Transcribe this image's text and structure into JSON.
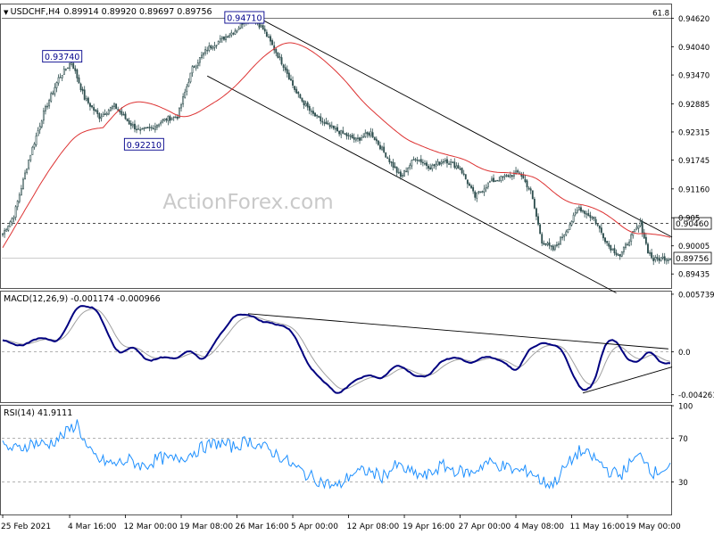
{
  "header": {
    "symbol_timeframe": "USDCHF,H4",
    "ohlc": "0.89914 0.89920 0.89697 0.89756"
  },
  "watermark": "ActionForex.com",
  "chart_data": [
    {
      "type": "candlestick",
      "title": "USDCHF,H4 0.89914 0.89920 0.89697 0.89756",
      "ylim": [
        0.8915,
        0.949
      ],
      "y_ticks": [
        {
          "value": 0.9462,
          "label": "0.94620"
        },
        {
          "value": 0.9404,
          "label": "0.94040"
        },
        {
          "value": 0.9347,
          "label": "0.93470"
        },
        {
          "value": 0.92885,
          "label": "0.92885"
        },
        {
          "value": 0.92315,
          "label": "0.92315"
        },
        {
          "value": 0.91745,
          "label": "0.91745"
        },
        {
          "value": 0.9116,
          "label": "0.91160"
        },
        {
          "value": 0.90575,
          "label": "0.905"
        },
        {
          "value": 0.90005,
          "label": "0.90005"
        },
        {
          "value": 0.89435,
          "label": "0.89435"
        }
      ],
      "x_ticks": [
        {
          "bar": 0,
          "label": "25 Feb 2021"
        },
        {
          "bar": 36,
          "label": "4 Mar 16:00"
        },
        {
          "bar": 66,
          "label": "12 Mar 00:00"
        },
        {
          "bar": 96,
          "label": "19 Mar 08:00"
        },
        {
          "bar": 126,
          "label": "26 Mar 16:00"
        },
        {
          "bar": 156,
          "label": "5 Apr 00:00"
        },
        {
          "bar": 186,
          "label": "12 Apr 08:00"
        },
        {
          "bar": 216,
          "label": "19 Apr 16:00"
        },
        {
          "bar": 246,
          "label": "27 Apr 00:00"
        },
        {
          "bar": 276,
          "label": "4 May 08:00"
        },
        {
          "bar": 306,
          "label": "11 May 16:00"
        },
        {
          "bar": 336,
          "label": "19 May 00:00"
        }
      ],
      "bar_count": 360,
      "anchors": [
        [
          0,
          0.9025
        ],
        [
          6,
          0.9062
        ],
        [
          14,
          0.9175
        ],
        [
          22,
          0.927
        ],
        [
          30,
          0.934
        ],
        [
          37,
          0.9374
        ],
        [
          44,
          0.93
        ],
        [
          52,
          0.9262
        ],
        [
          60,
          0.9285
        ],
        [
          68,
          0.925
        ],
        [
          74,
          0.9232
        ],
        [
          80,
          0.924
        ],
        [
          88,
          0.9258
        ],
        [
          94,
          0.9263
        ],
        [
          102,
          0.936
        ],
        [
          110,
          0.94
        ],
        [
          118,
          0.942
        ],
        [
          126,
          0.944
        ],
        [
          133,
          0.9471
        ],
        [
          140,
          0.944
        ],
        [
          146,
          0.94
        ],
        [
          152,
          0.936
        ],
        [
          158,
          0.931
        ],
        [
          166,
          0.927
        ],
        [
          174,
          0.9245
        ],
        [
          182,
          0.923
        ],
        [
          190,
          0.9215
        ],
        [
          198,
          0.923
        ],
        [
          206,
          0.9185
        ],
        [
          214,
          0.914
        ],
        [
          222,
          0.918
        ],
        [
          230,
          0.916
        ],
        [
          238,
          0.9175
        ],
        [
          246,
          0.9158
        ],
        [
          254,
          0.91
        ],
        [
          262,
          0.913
        ],
        [
          270,
          0.914
        ],
        [
          278,
          0.915
        ],
        [
          284,
          0.911
        ],
        [
          290,
          0.901
        ],
        [
          296,
          0.8993
        ],
        [
          302,
          0.9025
        ],
        [
          310,
          0.9078
        ],
        [
          318,
          0.9055
        ],
        [
          326,
          0.9
        ],
        [
          332,
          0.898
        ],
        [
          338,
          0.902
        ],
        [
          343,
          0.9046
        ],
        [
          347,
          0.899
        ],
        [
          350,
          0.8972
        ],
        [
          355,
          0.8976
        ]
      ],
      "series": [
        {
          "name": "Moving average",
          "color": "#dd3333",
          "period": 55
        }
      ],
      "lines": {
        "fib_level": {
          "value": 0.9462,
          "label": "61.8"
        },
        "dashed_level": {
          "value": 0.9046
        },
        "current_price": {
          "value": 0.89756
        }
      },
      "price_labels": [
        {
          "text": "0.94710",
          "bar": 130,
          "value": 0.9471
        },
        {
          "text": "0.93740",
          "bar": 32,
          "value": 0.9374
        },
        {
          "text": "0.92210",
          "bar": 76,
          "value": 0.9221
        },
        {
          "text": "0.90460",
          "axis": true,
          "value": 0.9046
        },
        {
          "text": "0.89756",
          "axis": true,
          "value": 0.89756
        }
      ],
      "channel": [
        {
          "from_bar": 133,
          "from_value": 0.9472,
          "to_bar": 360,
          "to_value": 0.9018
        },
        {
          "from_bar": 110,
          "from_value": 0.9345,
          "to_bar": 330,
          "to_value": 0.8905
        }
      ]
    },
    {
      "type": "line",
      "title": "MACD(12,26,9) -0.001174 -0.000966",
      "ylim": [
        -0.005,
        0.006
      ],
      "y_ticks": [
        {
          "value": 0.005739,
          "label": "0.005739"
        },
        {
          "value": 0.0,
          "label": "0.0"
        },
        {
          "value": -0.004261,
          "label": "-0.004261"
        }
      ],
      "series": [
        {
          "name": "",
          "color": "#000080"
        },
        {
          "name": "",
          "color": "#a0a0a0"
        }
      ],
      "anchors": [
        [
          0,
          0.0012
        ],
        [
          10,
          0.0005
        ],
        [
          20,
          0.0015
        ],
        [
          30,
          0.001
        ],
        [
          40,
          0.0045
        ],
        [
          50,
          0.0045
        ],
        [
          56,
          0.002
        ],
        [
          62,
          -0.0002
        ],
        [
          70,
          0.0005
        ],
        [
          78,
          -0.001
        ],
        [
          86,
          -0.0005
        ],
        [
          92,
          -0.0008
        ],
        [
          100,
          0.0003
        ],
        [
          108,
          -0.001
        ],
        [
          116,
          0.0015
        ],
        [
          124,
          0.0035
        ],
        [
          132,
          0.0038
        ],
        [
          140,
          0.003
        ],
        [
          148,
          0.0028
        ],
        [
          156,
          0.002
        ],
        [
          164,
          -0.0012
        ],
        [
          172,
          -0.003
        ],
        [
          180,
          -0.0042
        ],
        [
          188,
          -0.003
        ],
        [
          196,
          -0.0022
        ],
        [
          204,
          -0.0027
        ],
        [
          212,
          -0.0012
        ],
        [
          220,
          -0.0022
        ],
        [
          228,
          -0.0025
        ],
        [
          236,
          -0.0008
        ],
        [
          244,
          -0.0005
        ],
        [
          252,
          -0.0012
        ],
        [
          260,
          -0.0005
        ],
        [
          268,
          -0.0008
        ],
        [
          276,
          -0.002
        ],
        [
          284,
          0.0005
        ],
        [
          292,
          0.001
        ],
        [
          300,
          0.0005
        ],
        [
          306,
          -0.002
        ],
        [
          312,
          -0.004
        ],
        [
          318,
          -0.0032
        ],
        [
          324,
          0.001
        ],
        [
          330,
          0.0012
        ],
        [
          336,
          -0.0008
        ],
        [
          342,
          -0.001
        ],
        [
          348,
          0.0003
        ],
        [
          354,
          -0.0012
        ],
        [
          358,
          -0.001
        ]
      ],
      "trendlines": [
        {
          "from_bar": 132,
          "from_value": 0.0038,
          "to_bar": 358,
          "to_value": 0.0003
        },
        {
          "from_bar": 312,
          "from_value": -0.0041,
          "to_bar": 360,
          "to_value": -0.0015
        }
      ]
    },
    {
      "type": "line",
      "title": "RSI(14) 41.9111",
      "ylim": [
        0,
        100
      ],
      "y_ticks": [
        {
          "value": 100,
          "label": "100"
        },
        {
          "value": 70,
          "label": "70"
        },
        {
          "value": 30,
          "label": "30"
        }
      ],
      "levels": [
        70,
        30
      ],
      "series": [
        {
          "name": "",
          "color": "#1e90ff"
        }
      ],
      "anchors": [
        [
          0,
          62
        ],
        [
          8,
          60
        ],
        [
          16,
          66
        ],
        [
          24,
          64
        ],
        [
          32,
          72
        ],
        [
          40,
          84
        ],
        [
          46,
          58
        ],
        [
          52,
          50
        ],
        [
          60,
          46
        ],
        [
          68,
          50
        ],
        [
          76,
          44
        ],
        [
          84,
          52
        ],
        [
          92,
          50
        ],
        [
          100,
          55
        ],
        [
          108,
          62
        ],
        [
          116,
          66
        ],
        [
          124,
          62
        ],
        [
          132,
          68
        ],
        [
          140,
          62
        ],
        [
          148,
          55
        ],
        [
          156,
          45
        ],
        [
          164,
          36
        ],
        [
          172,
          30
        ],
        [
          180,
          25
        ],
        [
          188,
          38
        ],
        [
          196,
          40
        ],
        [
          204,
          35
        ],
        [
          212,
          45
        ],
        [
          220,
          38
        ],
        [
          228,
          35
        ],
        [
          236,
          45
        ],
        [
          244,
          40
        ],
        [
          252,
          38
        ],
        [
          260,
          48
        ],
        [
          268,
          45
        ],
        [
          276,
          40
        ],
        [
          284,
          40
        ],
        [
          290,
          30
        ],
        [
          296,
          28
        ],
        [
          302,
          42
        ],
        [
          310,
          58
        ],
        [
          318,
          52
        ],
        [
          326,
          40
        ],
        [
          332,
          36
        ],
        [
          338,
          48
        ],
        [
          344,
          55
        ],
        [
          350,
          38
        ],
        [
          355,
          42
        ]
      ]
    }
  ],
  "macd_panel": {
    "label": "MACD(12,26,9) -0.001174 -0.000966"
  },
  "rsi_panel": {
    "label": "RSI(14) 41.9111"
  },
  "colors": {
    "candle": "#2f4f4f",
    "ma": "#dd3333",
    "channel": "#000000",
    "macd": "#000080",
    "signal": "#a0a0a0",
    "rsi": "#1e90ff",
    "grid": "#999999"
  }
}
